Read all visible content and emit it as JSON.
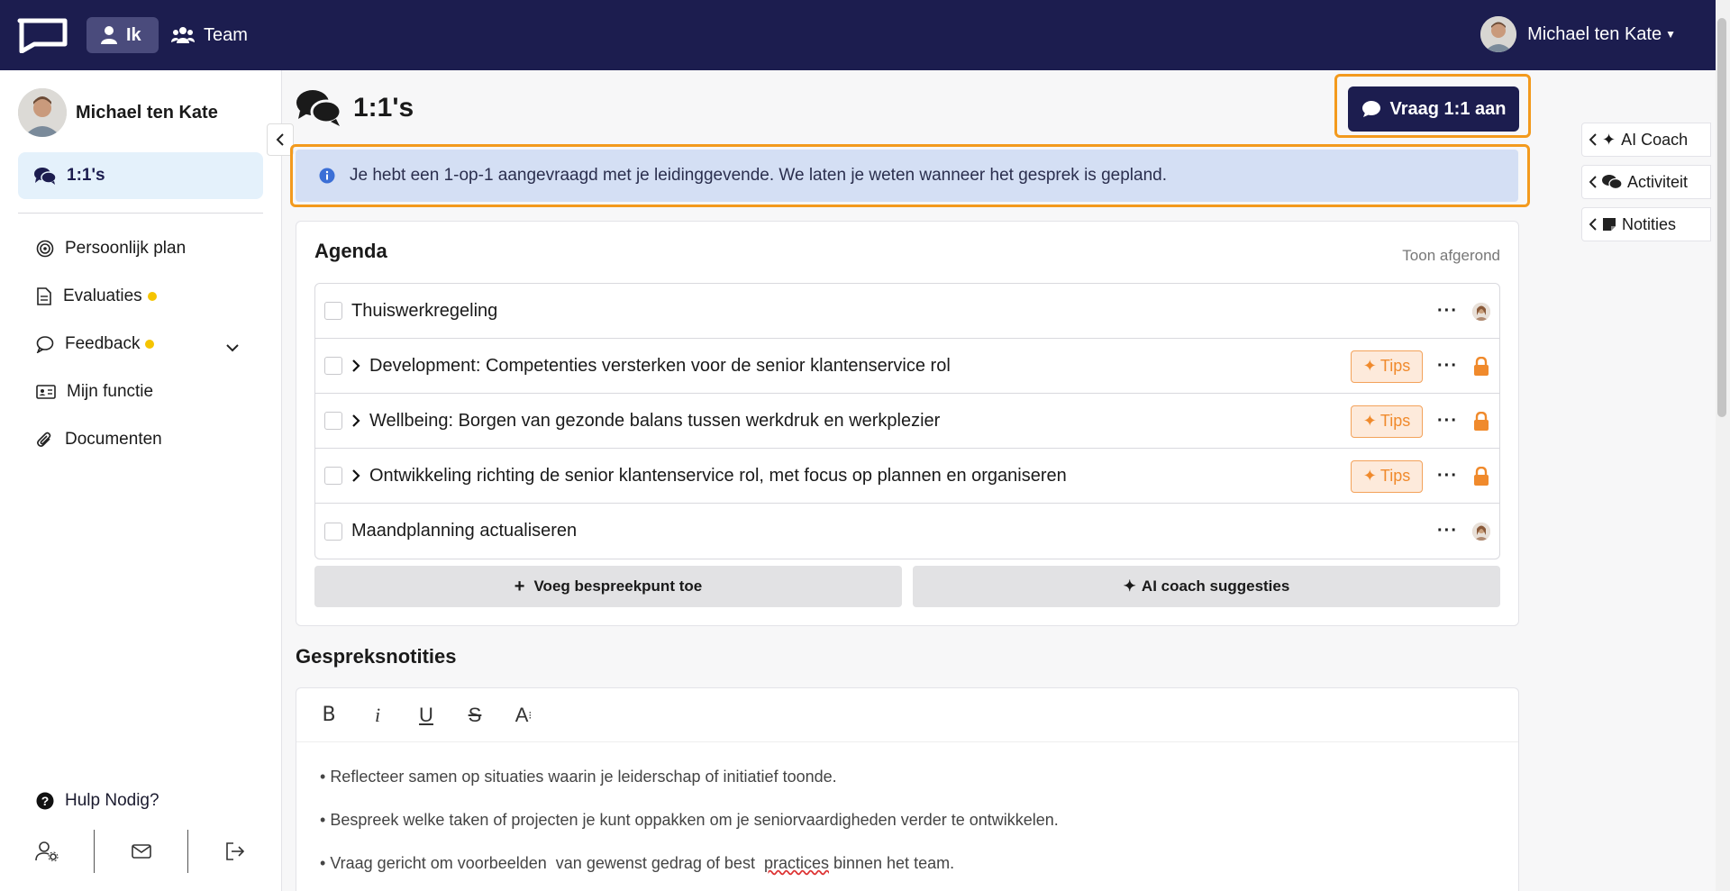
{
  "topbar": {
    "nav_ik": "Ik",
    "nav_team": "Team",
    "user_name": "Michael ten Kate"
  },
  "sidebar": {
    "profile_name": "Michael ten Kate",
    "active_item": "1:1's",
    "items": [
      {
        "label": "Persoonlijk plan",
        "icon": "target-icon"
      },
      {
        "label": "Evaluaties",
        "icon": "document-icon",
        "dot": true
      },
      {
        "label": "Feedback",
        "icon": "chat-icon",
        "dot": true
      },
      {
        "label": "Mijn functie",
        "icon": "id-card-icon"
      },
      {
        "label": "Documenten",
        "icon": "paperclip-icon"
      }
    ],
    "help": "Hulp Nodig?"
  },
  "main": {
    "title": "1:1's",
    "request_button": "Vraag 1:1 aan",
    "info_message": "Je hebt een 1-op-1 aangevraagd met je leidinggevende. We laten je weten wanneer het gesprek is gepland.",
    "agenda": {
      "title": "Agenda",
      "show_done": "Toon afgerond",
      "items": [
        {
          "text": "Thuiswerkregeling"
        },
        {
          "text": "Development: Competenties versterken voor de senior klantenservice rol",
          "tips": "Tips"
        },
        {
          "text": "Wellbeing: Borgen van gezonde balans tussen werkdruk en werkplezier",
          "tips": "Tips"
        },
        {
          "text": "Ontwikkeling richting de senior klantenservice rol, met focus op plannen en organiseren",
          "tips": "Tips"
        },
        {
          "text": "Maandplanning actualiseren"
        }
      ],
      "add_button": "Voeg bespreekpunt toe",
      "ai_button": "AI coach suggesties"
    },
    "notes": {
      "title": "Gespreksnotities",
      "toolbar": {
        "bold": "B",
        "italic": "i",
        "underline": "U",
        "strike": "S",
        "size": "A"
      },
      "lines": [
        "Reflecteer samen op situaties  waarin je leiderschap of initiatief  toonde.",
        "Bespreek  welke taken of projecten je  kunt oppakken om je seniorvaardigheden  verder te ontwikkelen."
      ],
      "line3_a": "Vraag gericht om voorbeelden  van gewenst gedrag of best  ",
      "line3_b": "practices",
      "line3_c": " binnen het team."
    }
  },
  "right_tabs": {
    "ai_coach": "AI Coach",
    "activity": "Activiteit",
    "notes": "Notities"
  },
  "colors": {
    "navy": "#1c1d4f",
    "orange": "#f39a1d",
    "info_bg": "#d4dff4",
    "tips_orange": "#f08a2c"
  }
}
